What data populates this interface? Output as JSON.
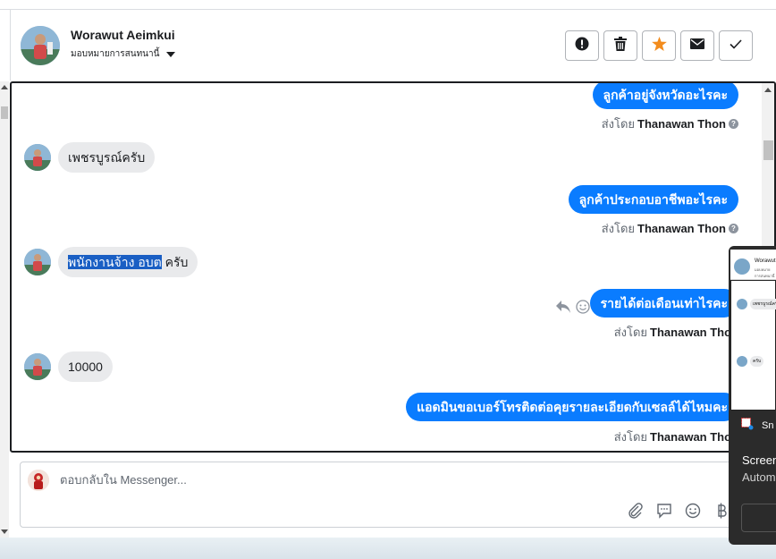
{
  "header": {
    "user_name": "Worawut Aeimkui",
    "assign_label": "มอบหมายการสนทนานี้",
    "actions": [
      {
        "name": "alert-button",
        "icon": "exclamation-icon"
      },
      {
        "name": "delete-button",
        "icon": "trash-icon"
      },
      {
        "name": "star-button",
        "icon": "star-icon"
      },
      {
        "name": "mail-button",
        "icon": "envelope-icon"
      },
      {
        "name": "done-button",
        "icon": "check-icon"
      }
    ]
  },
  "conversation": {
    "sent_by_prefix": "ส่งโดย",
    "sender": "Thanawan Thon",
    "messages": [
      {
        "dir": "out",
        "text": "ลูกค้าอยู่จังหวัดอะไรคะ"
      },
      {
        "dir": "in",
        "text": "เพชรบูรณ์ครับ"
      },
      {
        "dir": "out",
        "text": "ลูกค้าประกอบอาชีพอะไรคะ"
      },
      {
        "dir": "in",
        "highlighted": "พนักงานจ้าง อบต",
        "text": " ครับ"
      },
      {
        "dir": "out",
        "text": "รายได้ต่อเดือนเท่าไรคะ"
      },
      {
        "dir": "in",
        "text": "10000"
      },
      {
        "dir": "out",
        "text": "แอดมินขอเบอร์โทรติดต่อคุยรายละเอียดกับเซลล์ได้ไหมคะ"
      }
    ]
  },
  "reply": {
    "placeholder": "ตอบกลับใน Messenger...",
    "tools": [
      "paperclip-icon",
      "speech-bubble-icon",
      "smiley-icon",
      "baht-icon"
    ]
  },
  "snip_overlay": {
    "preview_name": "Worawut",
    "preview_sub": "มอบหมายการสนทนานี้",
    "preview_msg_1": "เพชรบูรณ์ครับ",
    "preview_msg_2": "ครับ",
    "app_label": "Sn",
    "title_line_1": "Screen",
    "title_line_2": "Autom"
  },
  "colors": {
    "messenger_blue": "#0a7cff",
    "incoming_bubble": "#e9eaec",
    "star_orange": "#f38c1d",
    "highlight": "#1a5fc4"
  }
}
